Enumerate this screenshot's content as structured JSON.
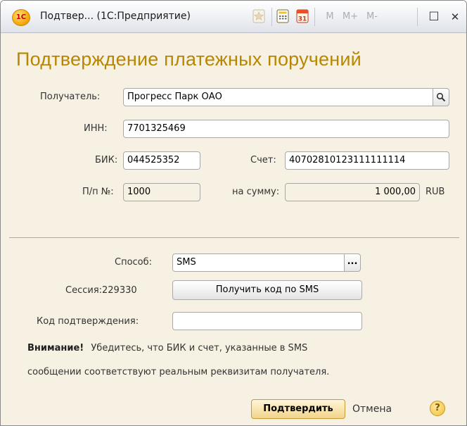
{
  "window": {
    "title": "Подтвер... (1С:Предприятие)",
    "logo_text": "1С",
    "toolbar": {
      "m_label": "M",
      "mplus_label": "M+",
      "mminus_label": "M-",
      "calendar_number": "31",
      "maximize_glyph": "☐",
      "close_glyph": "✕"
    }
  },
  "form": {
    "heading": "Подтверждение платежных поручений",
    "recipient": {
      "label": "Получатель:",
      "value": "Прогресс Парк ОАО"
    },
    "inn": {
      "label": "ИНН:",
      "value": "7701325469"
    },
    "bik": {
      "label": "БИК:",
      "value": "044525352"
    },
    "account": {
      "label": "Счет:",
      "value": "40702810123111111114"
    },
    "pp_number": {
      "label": "П/п №:",
      "value": "1000"
    },
    "amount": {
      "label": "на сумму:",
      "value": "1 000,00",
      "currency": "RUB"
    },
    "method": {
      "label": "Способ:",
      "value": "SMS",
      "button": "..."
    },
    "session": {
      "label": "Сессия:229330",
      "button": "Получить код по SMS"
    },
    "code": {
      "label": "Код подтверждения:",
      "value": "",
      "placeholder": ""
    },
    "warning": {
      "title": "Внимание!",
      "line1": "Убедитесь, что БИК и счет, указанные в SMS",
      "line2": "сообщении соответствуют реальным реквизитам получателя."
    },
    "actions": {
      "confirm": "Подтвердить",
      "cancel": "Отмена",
      "help": "?"
    }
  },
  "colors": {
    "heading": "#b88600",
    "background": "#f6f1e2",
    "accent": "#f2d48a"
  },
  "icons": [
    "favorite-icon",
    "calculator-icon",
    "calendar-icon",
    "search-icon",
    "help-icon"
  ]
}
